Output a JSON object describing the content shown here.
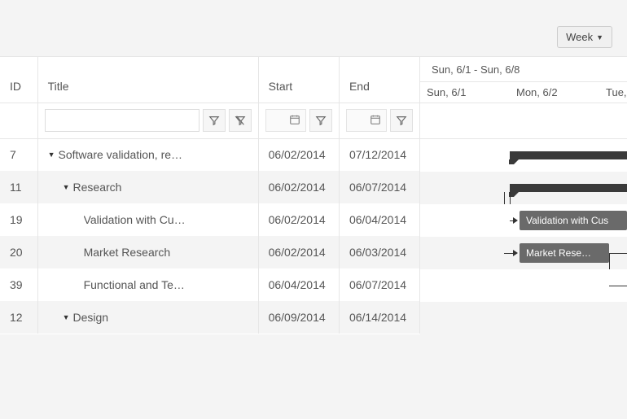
{
  "toolbar": {
    "view_label": "Week"
  },
  "columns": {
    "id": "ID",
    "title": "Title",
    "start": "Start",
    "end": "End"
  },
  "timeline": {
    "range": "Sun, 6/1 - Sun, 6/8",
    "days": [
      "Sun, 6/1",
      "Mon, 6/2",
      "Tue,"
    ]
  },
  "rows": [
    {
      "id": "7",
      "title": "Software validation, re…",
      "start": "06/02/2014",
      "end": "07/12/2014",
      "indent": 1,
      "expander": true
    },
    {
      "id": "11",
      "title": "Research",
      "start": "06/02/2014",
      "end": "06/07/2014",
      "indent": 2,
      "expander": true
    },
    {
      "id": "19",
      "title": "Validation with Cu…",
      "start": "06/02/2014",
      "end": "06/04/2014",
      "indent": 3,
      "expander": false
    },
    {
      "id": "20",
      "title": "Market Research",
      "start": "06/02/2014",
      "end": "06/03/2014",
      "indent": 3,
      "expander": false
    },
    {
      "id": "39",
      "title": "Functional and Te…",
      "start": "06/04/2014",
      "end": "06/07/2014",
      "indent": 3,
      "expander": false
    },
    {
      "id": "12",
      "title": "Design",
      "start": "06/09/2014",
      "end": "06/14/2014",
      "indent": 2,
      "expander": true
    }
  ],
  "task_bars": {
    "t19": "Validation with Cus",
    "t20": "Market Rese…"
  }
}
